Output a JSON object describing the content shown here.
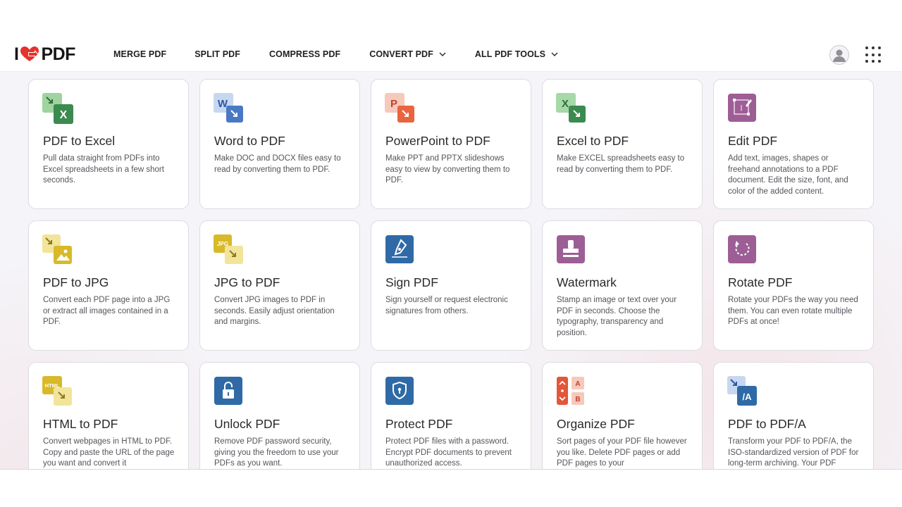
{
  "header": {
    "logo_left": "I",
    "logo_right": "PDF",
    "nav": [
      {
        "label": "MERGE PDF",
        "dropdown": false
      },
      {
        "label": "SPLIT PDF",
        "dropdown": false
      },
      {
        "label": "COMPRESS PDF",
        "dropdown": false
      },
      {
        "label": "CONVERT PDF",
        "dropdown": true
      },
      {
        "label": "ALL PDF TOOLS",
        "dropdown": true
      }
    ]
  },
  "colors": {
    "brand_red": "#e5322d",
    "excel_green": "#3b8a4f",
    "word_blue": "#3e6fba",
    "ppt_orange": "#e2573a",
    "edit_purple": "#9d5e95",
    "jpg_yellow": "#d8b929",
    "sign_blue": "#2f6aa6",
    "organize_red": "#e2573a"
  },
  "tools": [
    {
      "title": "PDF to Excel",
      "desc": "Pull data straight from PDFs into Excel spreadsheets in a few short seconds.",
      "icon": "pdf-to-excel-icon"
    },
    {
      "title": "Word to PDF",
      "desc": "Make DOC and DOCX files easy to read by converting them to PDF.",
      "icon": "word-to-pdf-icon"
    },
    {
      "title": "PowerPoint to PDF",
      "desc": "Make PPT and PPTX slideshows easy to view by converting them to PDF.",
      "icon": "powerpoint-to-pdf-icon"
    },
    {
      "title": "Excel to PDF",
      "desc": "Make EXCEL spreadsheets easy to read by converting them to PDF.",
      "icon": "excel-to-pdf-icon"
    },
    {
      "title": "Edit PDF",
      "desc": "Add text, images, shapes or freehand annotations to a PDF document. Edit the size, font, and color of the added content.",
      "icon": "edit-pdf-icon"
    },
    {
      "title": "PDF to JPG",
      "desc": "Convert each PDF page into a JPG or extract all images contained in a PDF.",
      "icon": "pdf-to-jpg-icon"
    },
    {
      "title": "JPG to PDF",
      "desc": "Convert JPG images to PDF in seconds. Easily adjust orientation and margins.",
      "icon": "jpg-to-pdf-icon"
    },
    {
      "title": "Sign PDF",
      "desc": "Sign yourself or request electronic signatures from others.",
      "icon": "sign-pdf-icon"
    },
    {
      "title": "Watermark",
      "desc": "Stamp an image or text over your PDF in seconds. Choose the typography, transparency and position.",
      "icon": "watermark-icon"
    },
    {
      "title": "Rotate PDF",
      "desc": "Rotate your PDFs the way you need them. You can even rotate multiple PDFs at once!",
      "icon": "rotate-pdf-icon"
    },
    {
      "title": "HTML to PDF",
      "desc": "Convert webpages in HTML to PDF. Copy and paste the URL of the page you want and convert it",
      "icon": "html-to-pdf-icon"
    },
    {
      "title": "Unlock PDF",
      "desc": "Remove PDF password security, giving you the freedom to use your PDFs as you want.",
      "icon": "unlock-pdf-icon"
    },
    {
      "title": "Protect PDF",
      "desc": "Protect PDF files with a password. Encrypt PDF documents to prevent unauthorized access.",
      "icon": "protect-pdf-icon"
    },
    {
      "title": "Organize PDF",
      "desc": "Sort pages of your PDF file however you like. Delete PDF pages or add PDF pages to your",
      "icon": "organize-pdf-icon"
    },
    {
      "title": "PDF to PDF/A",
      "desc": "Transform your PDF to PDF/A, the ISO-standardized version of PDF for long-term archiving. Your PDF",
      "icon": "pdf-to-pdfa-icon"
    }
  ]
}
